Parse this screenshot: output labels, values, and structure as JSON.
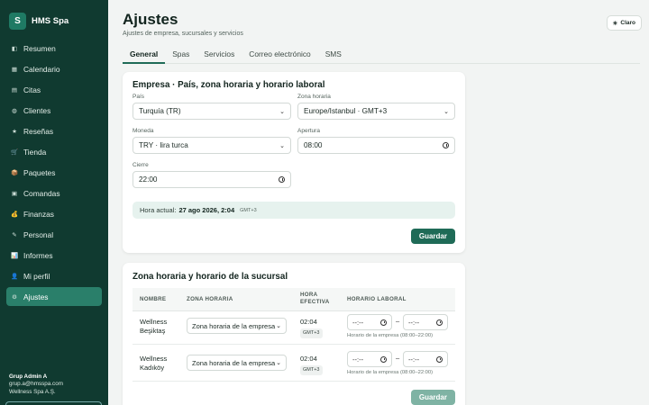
{
  "sidebar": {
    "logo_letter": "S",
    "brand": "HMS Spa",
    "items": [
      {
        "label": "Resumen",
        "icon": "◧"
      },
      {
        "label": "Calendario",
        "icon": "▦"
      },
      {
        "label": "Citas",
        "icon": "▤"
      },
      {
        "label": "Clientes",
        "icon": "◍"
      },
      {
        "label": "Reseñas",
        "icon": "★"
      },
      {
        "label": "Tienda",
        "icon": "🛒"
      },
      {
        "label": "Paquetes",
        "icon": "📦"
      },
      {
        "label": "Comandas",
        "icon": "▣"
      },
      {
        "label": "Finanzas",
        "icon": "💰"
      },
      {
        "label": "Personal",
        "icon": "✎"
      },
      {
        "label": "Informes",
        "icon": "📊"
      },
      {
        "label": "Mi perfil",
        "icon": "👤"
      },
      {
        "label": "Ajustes",
        "icon": "⚙"
      }
    ],
    "active_index": 12,
    "user": {
      "name": "Grup Admin A",
      "email": "grup.a@hmsspa.com",
      "company": "Wellness Spa A.Ş."
    }
  },
  "header": {
    "title": "Ajustes",
    "subtitle": "Ajustes de empresa, sucursales y servicios",
    "theme_icon": "☀",
    "theme_label": "Claro"
  },
  "tabs": [
    "General",
    "Spas",
    "Servicios",
    "Correo electrónico",
    "SMS"
  ],
  "company": {
    "title": "Empresa · País, zona horaria y horario laboral",
    "country_label": "País",
    "country_value": "Turquía (TR)",
    "timezone_label": "Zona horaria",
    "timezone_value": "Europe/Istanbul · GMT+3",
    "currency_label": "Moneda",
    "currency_value": "TRY · lira turca",
    "opening_label": "Apertura",
    "opening_value": "08:00",
    "closing_label": "Cierre",
    "closing_value": "22:00",
    "now_label": "Hora actual:",
    "now_value": "27 ago 2026, 2:04",
    "now_tz": "GMT+3",
    "save_label": "Guardar"
  },
  "branches": {
    "title": "Zona horaria y horario de la sucursal",
    "columns": [
      "NOMBRE",
      "ZONA HORARIA",
      "HORA EFECTIVA",
      "HORARIO LABORAL"
    ],
    "rows": [
      {
        "name_line1": "Wellness",
        "name_line2": "Beşiktaş",
        "zone": "Zona horaria de la empresa",
        "time": "02:04",
        "tz": "GMT+3",
        "start": "--:--",
        "end": "--:--",
        "dash": "–",
        "hint": "Horario de la empresa (08:00–22:00)"
      },
      {
        "name_line1": "Wellness",
        "name_line2": "Kadıköy",
        "zone": "Zona horaria de la empresa",
        "time": "02:04",
        "tz": "GMT+3",
        "start": "--:--",
        "end": "--:--",
        "dash": "–",
        "hint": "Horario de la empresa (08:00–22:00)"
      }
    ],
    "save_label": "Guardar"
  }
}
